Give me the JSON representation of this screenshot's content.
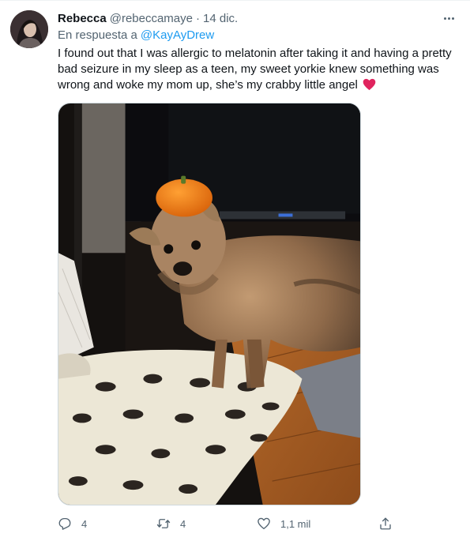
{
  "tweet": {
    "author_name": "Rebecca",
    "author_handle": "@rebeccamaye",
    "separator": "·",
    "timestamp": "14 dic.",
    "reply_prefix": "En respuesta a",
    "reply_to": "@KayAyDrew",
    "text": "I found out that I was allergic to melatonin after taking it and having a pretty bad seizure in my sleep as a teen, my sweet yorkie knew something was wrong and woke my mom up, she’s  my crabby little angel",
    "emoji": "red-heart-icon",
    "replies": "4",
    "retweets": "4",
    "likes": "1,1 mil"
  },
  "icons": {
    "more": "more-icon",
    "reply": "reply-icon",
    "retweet": "retweet-icon",
    "like": "like-icon",
    "share": "share-icon"
  },
  "colors": {
    "accent": "#1d9bf0",
    "secondary_text": "#536471",
    "heart": "#f4212e"
  }
}
